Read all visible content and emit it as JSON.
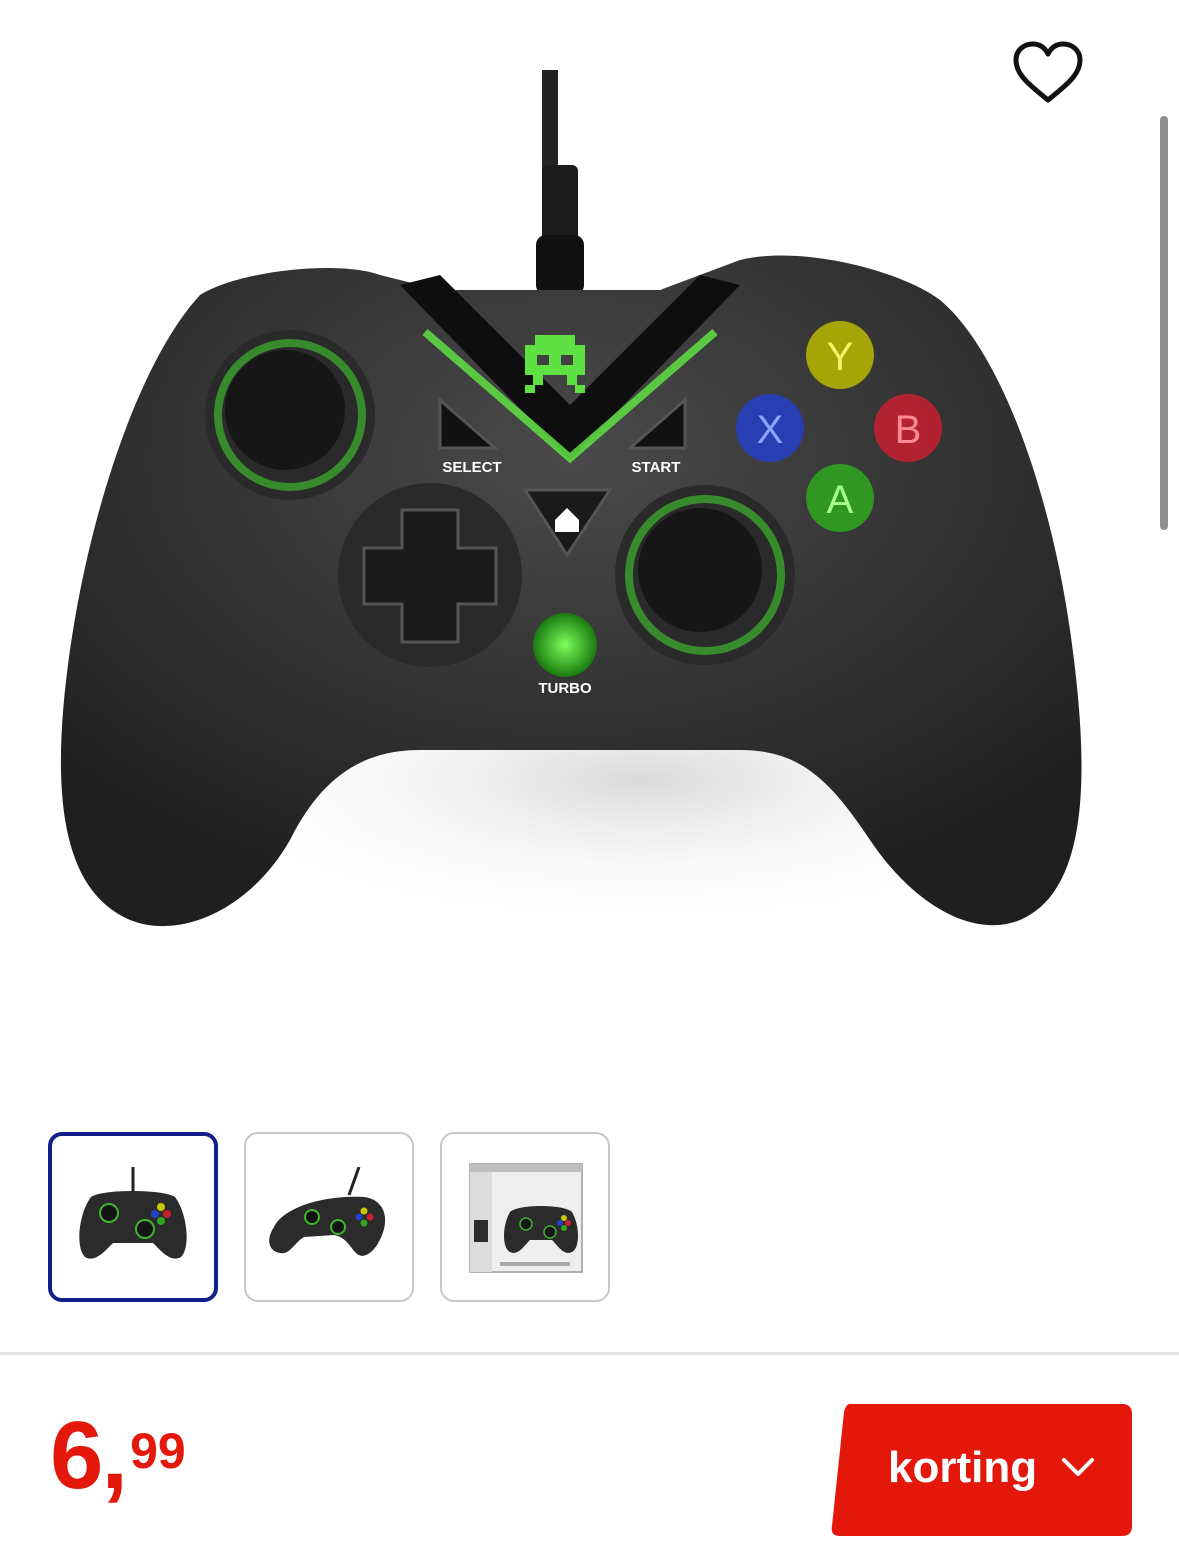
{
  "product": {
    "image_icon": "gamepad-controller",
    "controller_labels": {
      "select": "SELECT",
      "start": "START",
      "turbo": "TURBO",
      "y": "Y",
      "x": "X",
      "b": "B",
      "a": "A"
    },
    "thumbnails": [
      {
        "icon": "controller-front-thumbnail",
        "active": true
      },
      {
        "icon": "controller-angled-thumbnail",
        "active": false
      },
      {
        "icon": "controller-box-thumbnail",
        "active": false
      }
    ]
  },
  "favorite": {
    "icon": "heart-icon"
  },
  "price": {
    "whole": "6",
    "separator": ",",
    "cents": "99",
    "color": "#e3170a"
  },
  "discount_button": {
    "label": "korting",
    "icon": "chevron-down-icon",
    "color": "#e3170a"
  }
}
